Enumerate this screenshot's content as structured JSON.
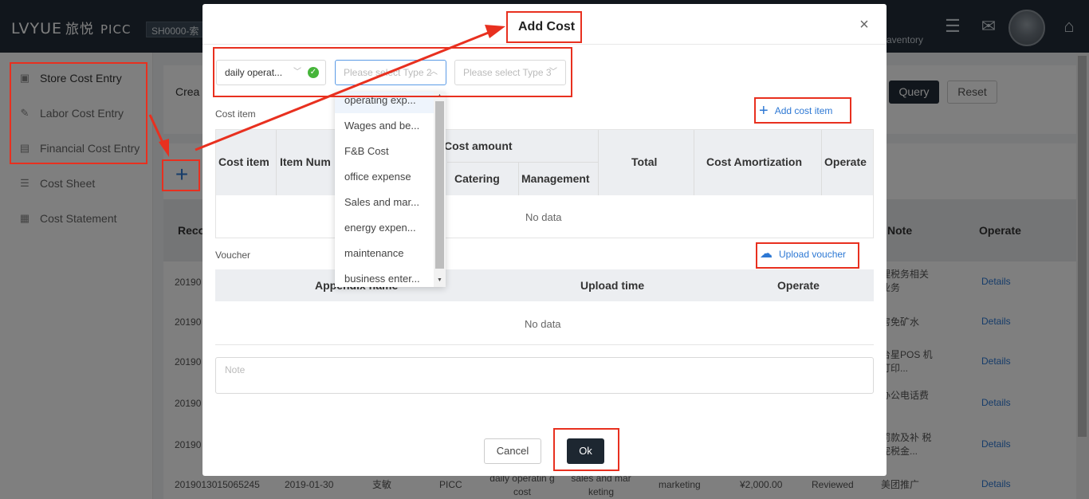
{
  "app": {
    "logo_text": "LVYUE",
    "logo_cn": "旅悦",
    "logo_sub": "PICC",
    "store_tag": "SH0000-索",
    "inventory_label": "aventory"
  },
  "sidebar": {
    "items": [
      {
        "label": "Store Cost Entry",
        "icon": "store-icon"
      },
      {
        "label": "Labor Cost Entry",
        "icon": "labor-icon"
      },
      {
        "label": "Financial Cost Entry",
        "icon": "finance-icon"
      },
      {
        "label": "Cost Sheet",
        "icon": "sheet-icon"
      },
      {
        "label": "Cost Statement",
        "icon": "statement-icon"
      }
    ]
  },
  "filters": {
    "created_label": "Crea",
    "query_label": "Query",
    "reset_label": "Reset",
    "add_icon": "plus-icon"
  },
  "bg_table": {
    "header_left": "Reco",
    "header_note": "Note",
    "header_operate": "Operate",
    "rows": [
      {
        "id": "20190",
        "note": "理税务相关业务",
        "op": "Details"
      },
      {
        "id": "20190",
        "note": "房免矿水",
        "op": "Details"
      },
      {
        "id": "20190",
        "note": "台星POS 机打印...",
        "op": "Details"
      },
      {
        "id": "20190",
        "note": "办公电话费",
        "op": "Details"
      },
      {
        "id": "20190",
        "note": "罚款及补 税完税金...",
        "op": "Details"
      }
    ],
    "last_row": {
      "id": "2019013015065245",
      "date": "2019-01-30",
      "person": "支敏",
      "org": "PICC",
      "type": "daily operatin g cost",
      "sub": "sales and mar keting",
      "cat": "marketing",
      "amount": "¥2,000.00",
      "status": "Reviewed",
      "note": "美团推广",
      "op": "Details"
    }
  },
  "modal": {
    "title": "Add Cost",
    "close_icon": "close-icon",
    "type1": {
      "value": "daily operat...",
      "status_icon": "check-icon"
    },
    "type2": {
      "placeholder": "Please select Type 2"
    },
    "type3": {
      "placeholder": "Please select Type 3"
    },
    "cost_item_label": "Cost item",
    "add_cost_item": "Add cost item",
    "cost_table": {
      "headers": {
        "cost_item": "Cost item",
        "item_number": "Item Num",
        "cost_amount": "Cost amount",
        "catering": "Catering",
        "management": "Management",
        "total": "Total",
        "amortization": "Cost Amortization",
        "operate": "Operate"
      },
      "empty": "No data"
    },
    "voucher_label": "Voucher",
    "upload_voucher": "Upload voucher",
    "voucher_table": {
      "headers": {
        "appendix": "Appendix name",
        "upload_time": "Upload time",
        "operate": "Operate"
      },
      "empty": "No data"
    },
    "note_placeholder": "Note",
    "cancel_label": "Cancel",
    "ok_label": "Ok"
  },
  "dropdown": {
    "options": [
      "operating exp...",
      "Wages and be...",
      "F&B Cost",
      "office expense",
      "Sales and mar...",
      "energy expen...",
      "maintenance",
      "business enter..."
    ]
  },
  "colors": {
    "topbar": "#232d38",
    "primary_dark": "#1d2731",
    "link": "#2d78d4",
    "annotation": "#e8301f",
    "success": "#46b53a"
  }
}
